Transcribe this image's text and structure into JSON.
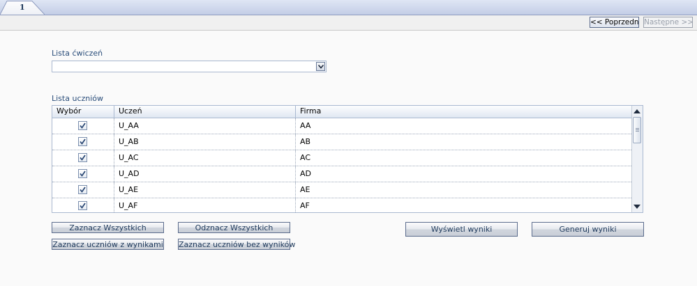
{
  "tab": {
    "label": "1"
  },
  "nav": {
    "prev_label": "<< Poprzedni",
    "next_label": "Następne >>"
  },
  "exercises": {
    "label": "Lista ćwiczeń",
    "selected": ""
  },
  "students": {
    "label": "Lista uczniów",
    "columns": [
      "Wybór",
      "Uczeń",
      "Firma"
    ],
    "rows": [
      {
        "checked": true,
        "student": "U_AA",
        "company": "AA"
      },
      {
        "checked": true,
        "student": "U_AB",
        "company": "AB"
      },
      {
        "checked": true,
        "student": "U_AC",
        "company": "AC"
      },
      {
        "checked": true,
        "student": "U_AD",
        "company": "AD"
      },
      {
        "checked": true,
        "student": "U_AE",
        "company": "AE"
      },
      {
        "checked": true,
        "student": "U_AF",
        "company": "AF"
      }
    ]
  },
  "buttons": {
    "select_all": "Zaznacz Wszystkich",
    "deselect_all": "Odznacz Wszystkich",
    "select_with_results": "Zaznacz uczniów z wynikami",
    "select_without_results": "Zaznacz uczniów bez wyników",
    "show_results": "Wyświetl wyniki",
    "generate_results": "Generuj wyniki"
  },
  "icons": {
    "combo_arrow": "chevron-down-icon",
    "checkbox": "checkmark-icon",
    "scroll_up": "scroll-up-arrow-icon",
    "scroll_down": "scroll-down-arrow-icon"
  },
  "colors": {
    "accent": "#1e395b",
    "border": "#a9b8d0",
    "tabstrip": "#c3cde6"
  }
}
